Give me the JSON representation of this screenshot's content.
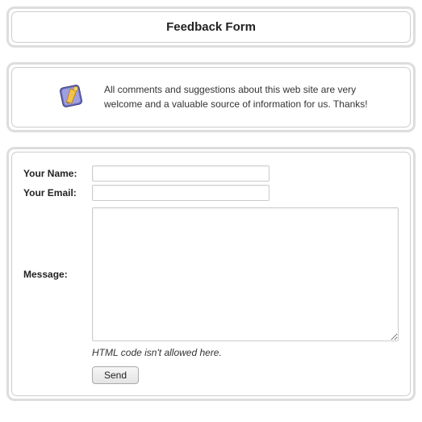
{
  "header": {
    "title": "Feedback Form"
  },
  "intro": {
    "icon": "feedback-note-icon",
    "text": "All comments and suggestions about this web site are very welcome and a valuable source of information for us. Thanks!"
  },
  "form": {
    "name": {
      "label": "Your Name:",
      "value": ""
    },
    "email": {
      "label": "Your Email:",
      "value": ""
    },
    "message": {
      "label": "Message:",
      "value": "",
      "hint": "HTML code isn't allowed here."
    },
    "submit_label": "Send"
  }
}
